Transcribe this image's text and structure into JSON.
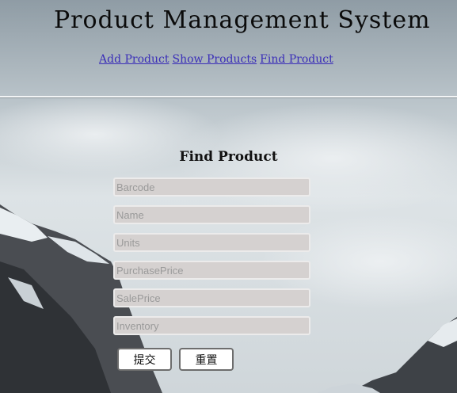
{
  "header": {
    "title": "Product Management System",
    "nav": [
      {
        "label": "Add Product"
      },
      {
        "label": "Show Products"
      },
      {
        "label": "Find Product"
      }
    ]
  },
  "main": {
    "section_title": "Find Product",
    "fields": [
      {
        "placeholder": "Barcode",
        "value": ""
      },
      {
        "placeholder": "Name",
        "value": ""
      },
      {
        "placeholder": "Units",
        "value": ""
      },
      {
        "placeholder": "PurchasePrice",
        "value": ""
      },
      {
        "placeholder": "SalePrice",
        "value": ""
      },
      {
        "placeholder": "Inventory",
        "value": ""
      }
    ],
    "submit_label": "提交",
    "reset_label": "重置"
  },
  "colors": {
    "link": "#3b2fb8",
    "field_bg": "#d5d1d0"
  }
}
